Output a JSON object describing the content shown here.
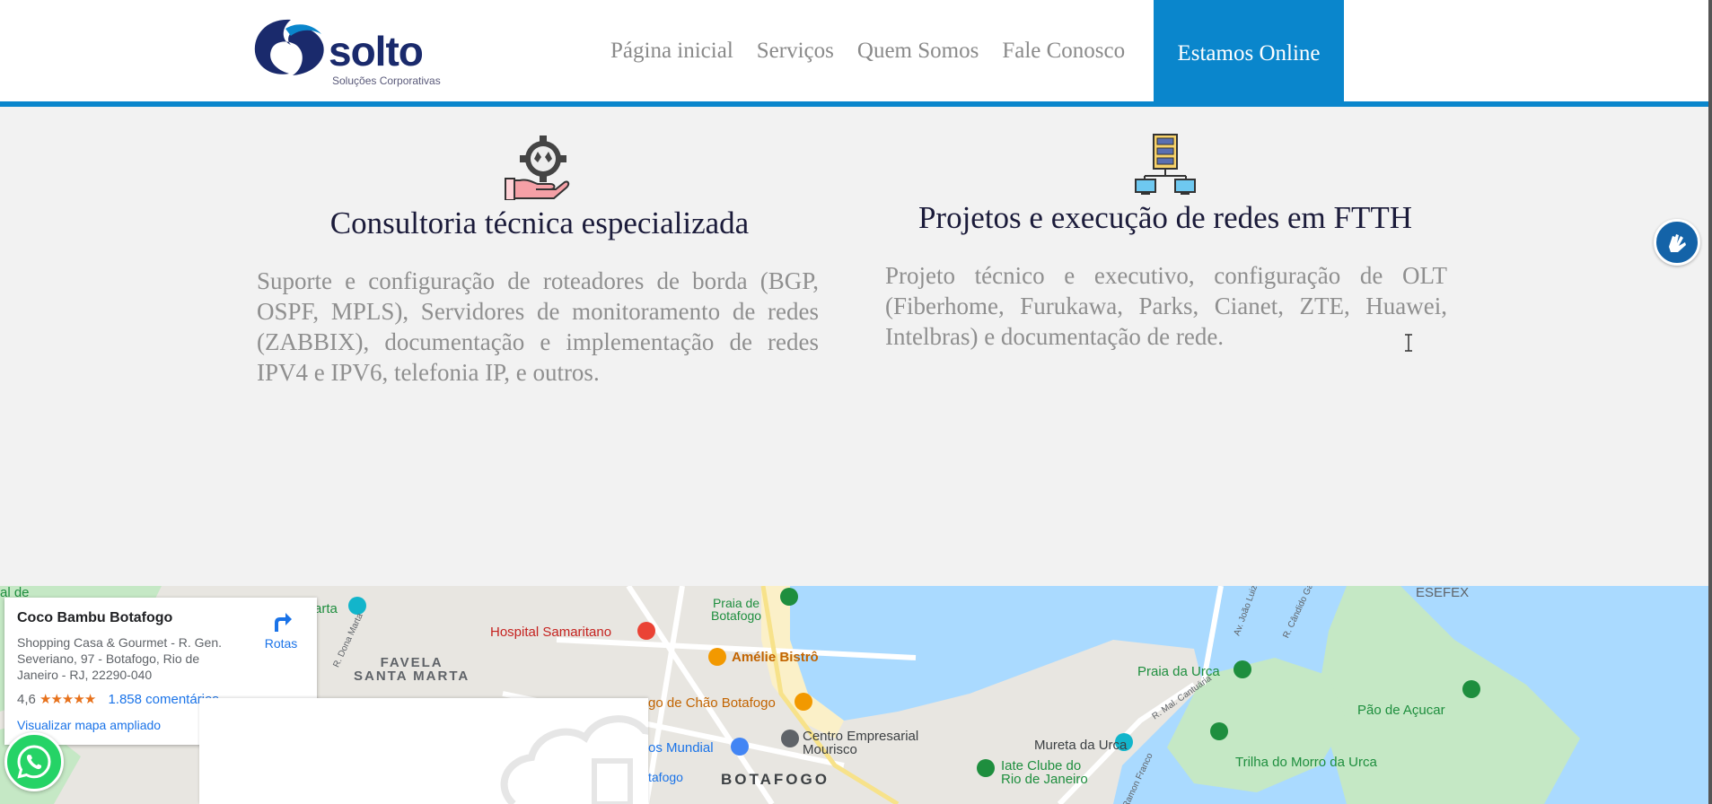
{
  "header": {
    "logo_text": "solto",
    "logo_subtitle": "Soluções Corporativas",
    "nav": [
      {
        "label": "Página inicial"
      },
      {
        "label": "Serviços"
      },
      {
        "label": "Quem Somos"
      },
      {
        "label": "Fale Conosco"
      }
    ],
    "cta_label": "Estamos Online"
  },
  "services": [
    {
      "icon": "hand-gear-icon",
      "title": "Consultoria técnica especializada",
      "description": "Suporte e configuração de roteadores de borda (BGP, OSPF, MPLS), Servidores de monitoramento de redes (ZABBIX), documentação e implementação de redes IPV4 e IPV6, telefonia IP, e outros."
    },
    {
      "icon": "server-network-icon",
      "title": "Projetos e execução de redes em FTTH",
      "description": "Projeto técnico e executivo, configuração de OLT (Fiberhome, Furukawa, Parks, Cianet, ZTE, Huawei, Intelbras) e documentação de rede."
    }
  ],
  "map": {
    "place_name": "Coco Bambu Botafogo",
    "address": "Shopping Casa & Gourmet - R. Gen. Severiano, 97 - Botafogo, Rio de Janeiro - RJ, 22290-040",
    "rating": "4,6",
    "stars": "★★★★★",
    "reviews": "1.858 comentários",
    "directions_label": "Rotas",
    "larger_map_link": "Visualizar mapa ampliado",
    "labels": {
      "praia_botafogo": "Praia de\nBotafogo",
      "hospital": "Hospital Samaritano",
      "favela": "FAVELA\nSANTA MARTA",
      "amelie": "Amélie Bistrô",
      "fogo": "go de Chão Botafogo",
      "centro": "Centro Empresarial\nMourisco",
      "mundial": "os Mundial",
      "botafogo_metro": "tafogo",
      "botafogo": "BOTAFOGO",
      "praia_urca": "Praia da Urca",
      "mureta": "Mureta da Urca",
      "iate": "Iate Clube do\nRio de Janeiro",
      "pao": "Pão de Açucar",
      "trilha": "Trilha do Morro da Urca",
      "esefex": "ESEFEX",
      "marta": "arta",
      "de": "al de",
      "dona_marta": "R. Dona Marta",
      "joao_luiz": "Av. João Luiz Alves",
      "candido": "R. Cândido Gaffrée",
      "cantuaria": "R. Mal. Cantuária",
      "ramon": "R. Ramon Franco"
    },
    "colors": {
      "water": "#aadaff",
      "land": "#e8e6e1",
      "park": "#c5e8c5",
      "beach": "#fbf0c8"
    }
  },
  "accent_color": "#0a86cc"
}
